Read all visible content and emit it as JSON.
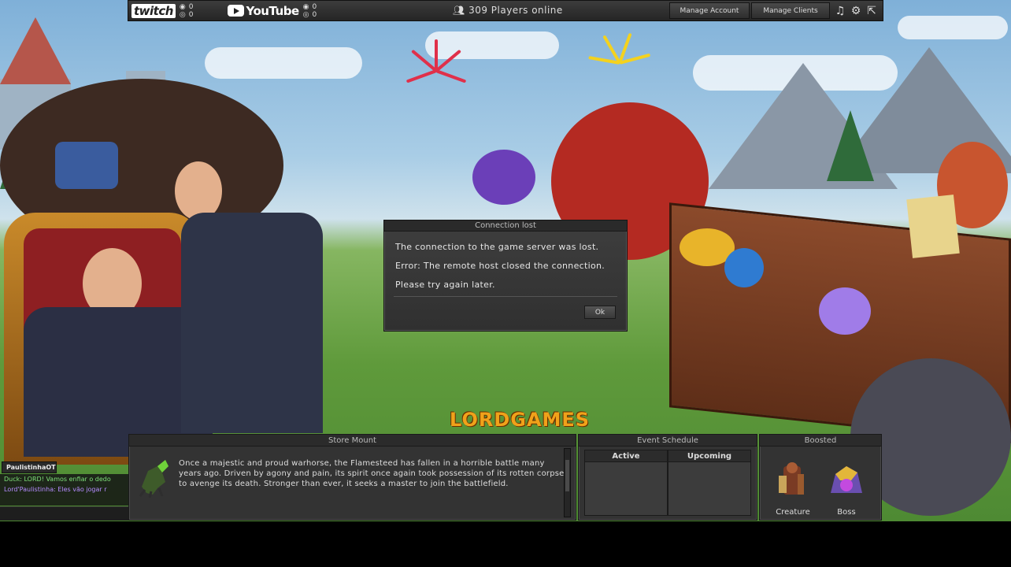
{
  "topbar": {
    "twitch": {
      "logo": "twitch",
      "viewers": "0",
      "followers": "0"
    },
    "youtube": {
      "logo": "YouTube",
      "viewers": "0",
      "followers": "0"
    },
    "players_online": "309 Players online",
    "manage_account": "Manage Account",
    "manage_clients": "Manage Clients"
  },
  "modal": {
    "title": "Connection lost",
    "line1": "The connection to the game server was lost.",
    "line2": "Error: The remote host closed the connection.",
    "line3": "Please try again later.",
    "ok": "Ok"
  },
  "logo": "LORDGAMES",
  "store": {
    "title": "Store Mount",
    "description": "Once a majestic and proud warhorse, the Flamesteed has fallen in a horrible battle many years ago. Driven by agony and pain, its spirit once again took possession of its rotten corpse to avenge its death. Stronger than ever, it seeks a master to join the battlefield."
  },
  "events": {
    "title": "Event Schedule",
    "active": "Active",
    "upcoming": "Upcoming"
  },
  "boosted": {
    "title": "Boosted",
    "creature": "Creature",
    "boss": "Boss"
  },
  "chat": {
    "tab": "PaulistinhaOT",
    "lines": [
      {
        "text": "Duck: LORD! Vamos enfiar o dedo",
        "color": "#7fe07a"
      },
      {
        "text": "Lord'Paulistinha: Eles vão jogar r",
        "color": "#b58cff"
      }
    ]
  },
  "colors": {
    "accent": "#f0a21a",
    "panel": "#333333"
  }
}
